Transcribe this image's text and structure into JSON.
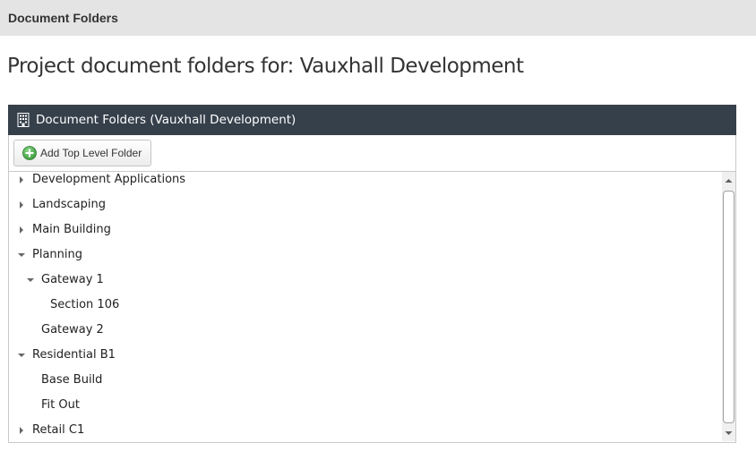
{
  "top_bar": {
    "title": "Document Folders"
  },
  "page": {
    "title": "Project document folders for: Vauxhall Development"
  },
  "panel": {
    "header_title": "Document Folders (Vauxhall Development)",
    "header_icon": "building-icon",
    "add_button_label": "Add Top Level Folder",
    "add_button_icon": "plus-circle-icon"
  },
  "tree": {
    "nodes": [
      {
        "label": "Development Applications",
        "level": 0,
        "state": "collapsed"
      },
      {
        "label": "Landscaping",
        "level": 0,
        "state": "collapsed"
      },
      {
        "label": "Main Building",
        "level": 0,
        "state": "collapsed"
      },
      {
        "label": "Planning",
        "level": 0,
        "state": "expanded"
      },
      {
        "label": "Gateway 1",
        "level": 1,
        "state": "expanded"
      },
      {
        "label": "Section 106",
        "level": 2,
        "state": "leaf"
      },
      {
        "label": "Gateway 2",
        "level": 1,
        "state": "leaf"
      },
      {
        "label": "Residential B1",
        "level": 0,
        "state": "expanded"
      },
      {
        "label": "Base Build",
        "level": 1,
        "state": "leaf"
      },
      {
        "label": "Fit Out",
        "level": 1,
        "state": "leaf"
      },
      {
        "label": "Retail C1",
        "level": 0,
        "state": "collapsed"
      }
    ]
  },
  "colors": {
    "header_bg": "#36404b",
    "top_bar_bg": "#e4e4e4",
    "add_icon_green": "#5cb85c"
  }
}
